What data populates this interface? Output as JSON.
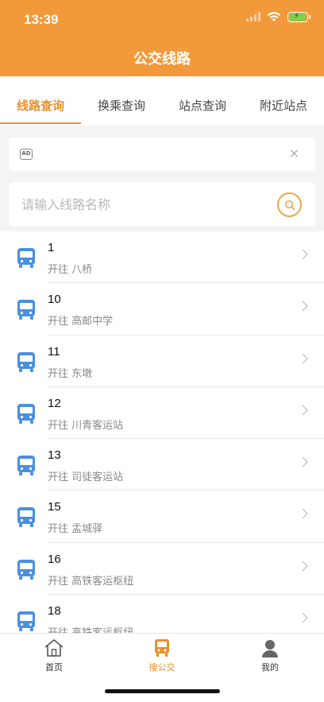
{
  "status": {
    "time": "13:39"
  },
  "header": {
    "title": "公交线路"
  },
  "tabs": [
    {
      "label": "线路查询",
      "active": true
    },
    {
      "label": "换乘查询",
      "active": false
    },
    {
      "label": "站点查询",
      "active": false
    },
    {
      "label": "附近站点",
      "active": false
    }
  ],
  "ad": {
    "badge": "AD",
    "close": "×"
  },
  "search": {
    "placeholder": "请输入线路名称",
    "value": ""
  },
  "routes": [
    {
      "number": "1",
      "dest": "开往 八桥"
    },
    {
      "number": "10",
      "dest": "开往 高邮中学"
    },
    {
      "number": "11",
      "dest": "开往 东墩"
    },
    {
      "number": "12",
      "dest": "开往 川青客运站"
    },
    {
      "number": "13",
      "dest": "开往 司徒客运站"
    },
    {
      "number": "15",
      "dest": "开往 盂城驿"
    },
    {
      "number": "16",
      "dest": "开往 高铁客运枢纽"
    },
    {
      "number": "18",
      "dest": "开往 高铁客运枢纽"
    }
  ],
  "nav": [
    {
      "label": "首页",
      "icon": "home-icon",
      "active": false
    },
    {
      "label": "搜公交",
      "icon": "bus-icon",
      "active": true
    },
    {
      "label": "我的",
      "icon": "user-icon",
      "active": false
    }
  ],
  "colors": {
    "accent": "#f29a3a",
    "bus_icon": "#4a8fe0"
  }
}
